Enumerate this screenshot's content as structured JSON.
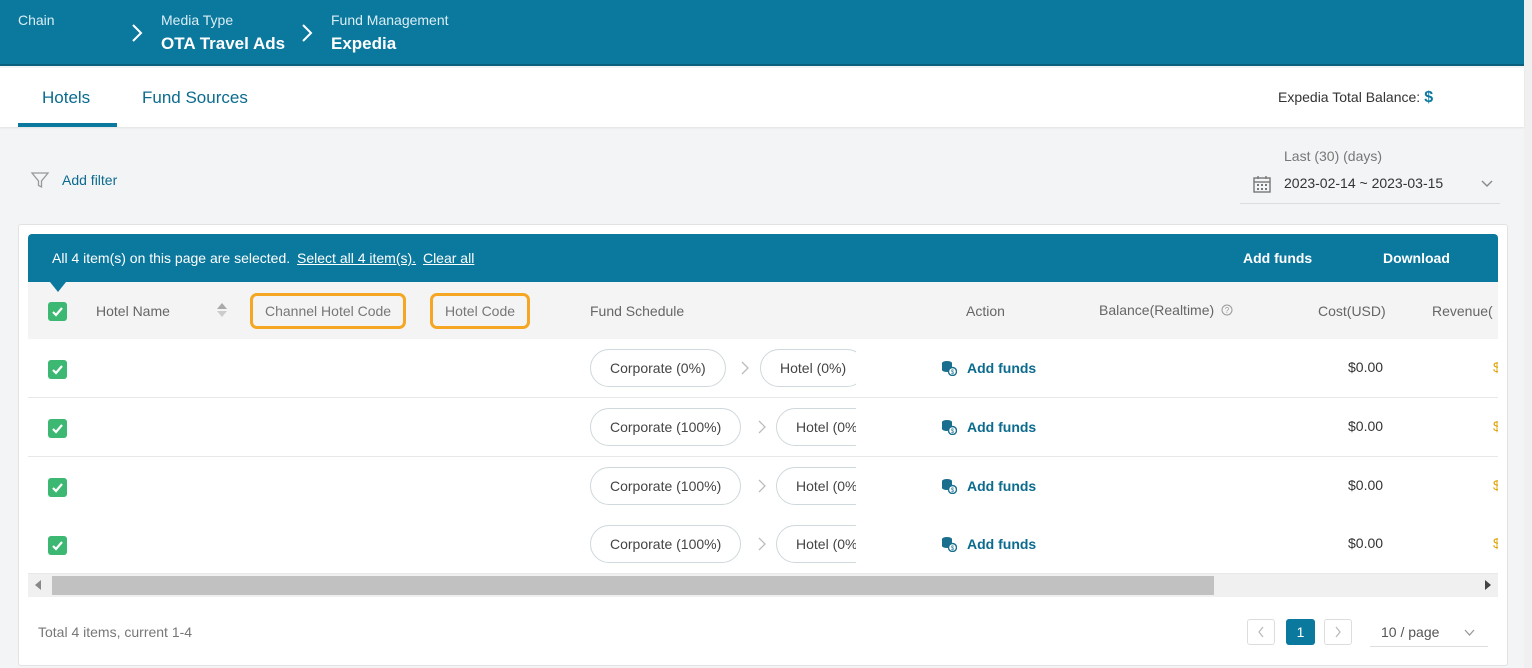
{
  "breadcrumb": {
    "items": [
      {
        "label": "Chain",
        "value": ""
      },
      {
        "label": "Media Type",
        "value": "OTA Travel Ads"
      },
      {
        "label": "Fund Management",
        "value": "Expedia"
      }
    ]
  },
  "tabs": [
    {
      "label": "Hotels",
      "active": true
    },
    {
      "label": "Fund Sources",
      "active": false
    }
  ],
  "balance": {
    "label": "Expedia Total Balance:",
    "value": "$"
  },
  "filter": {
    "label": "Add filter"
  },
  "date_range": {
    "label": "Last (30) (days)",
    "value": "2023-02-14 ~ 2023-03-15"
  },
  "selection_bar": {
    "message": "All 4 item(s) on this page are selected.",
    "select_all": "Select all 4 item(s).",
    "clear_all": "Clear all",
    "add_funds": "Add funds",
    "download": "Download"
  },
  "table": {
    "columns": [
      "Hotel Name",
      "Channel Hotel Code",
      "Hotel Code",
      "Fund Schedule",
      "Action",
      "Balance(Realtime)",
      "Cost(USD)",
      "Revenue("
    ],
    "rows": [
      {
        "hotel_name": "",
        "corporate": "Corporate (0%)",
        "hotel": "Hotel (0%)",
        "action": "Add funds",
        "cost": "$0.00",
        "revenue": "$"
      },
      {
        "hotel_name": "",
        "corporate": "Corporate (100%)",
        "hotel": "Hotel (0%",
        "action": "Add funds",
        "cost": "$0.00",
        "revenue": "$"
      },
      {
        "hotel_name": "",
        "corporate": "Corporate (100%)",
        "hotel": "Hotel (0%",
        "action": "Add funds",
        "cost": "$0.00",
        "revenue": "$"
      },
      {
        "hotel_name": "",
        "corporate": "Corporate (100%)",
        "hotel": "Hotel (0%",
        "action": "Add funds",
        "cost": "$0.00",
        "revenue": "$"
      }
    ]
  },
  "pagination": {
    "total": "Total 4 items, current 1-4",
    "current_page": "1",
    "page_size": "10 / page"
  },
  "colors": {
    "primary": "#0b789e",
    "checkbox": "#3cb873",
    "highlight": "#f5a623"
  }
}
